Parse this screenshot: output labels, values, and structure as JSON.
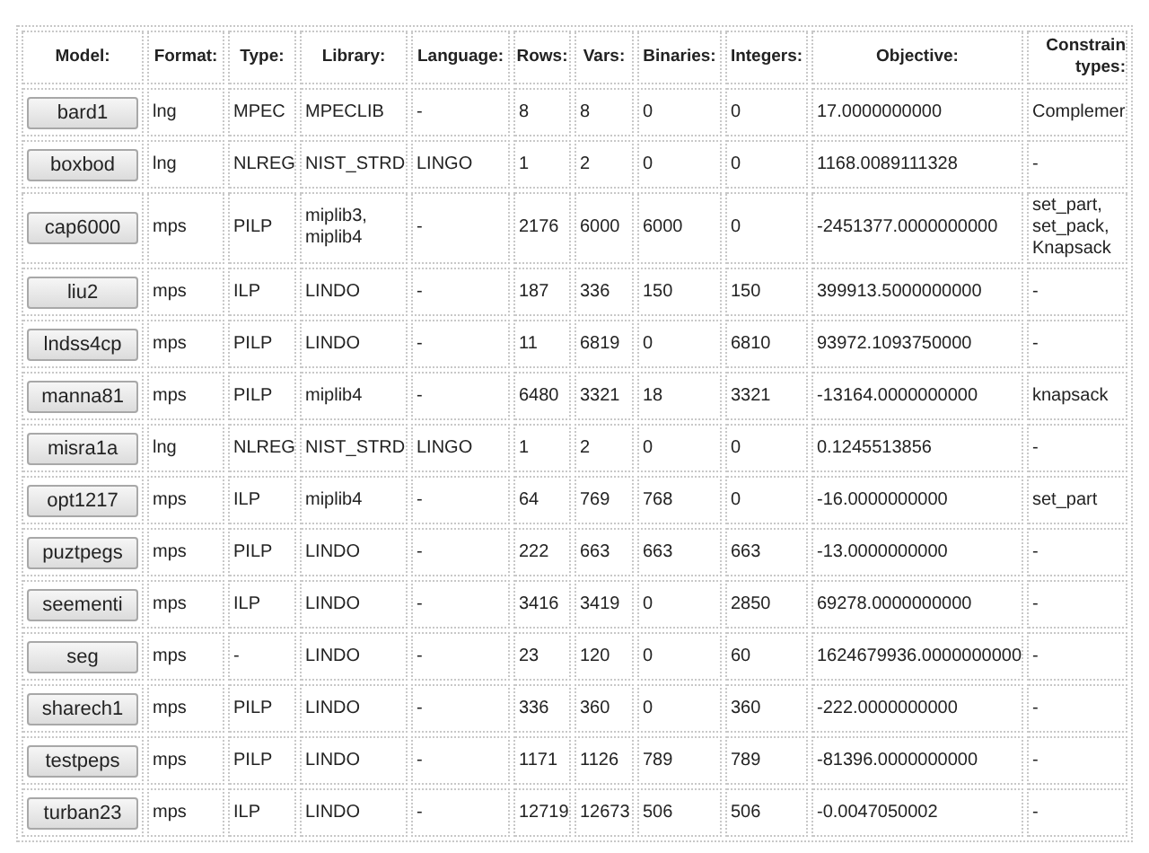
{
  "table": {
    "columns": [
      "Model:",
      "Format:",
      "Type:",
      "Library:",
      "Language:",
      "Rows:",
      "Vars:",
      "Binaries:",
      "Integers:",
      "Objective:",
      "Constrain types:"
    ],
    "rows": [
      {
        "cells": [
          "bard1",
          "lng",
          "MPEC",
          "MPECLIB",
          "-",
          "8",
          "8",
          "0",
          "0",
          "17.0000000000",
          "Complemer"
        ]
      },
      {
        "cells": [
          "boxbod",
          "lng",
          "NLREG",
          "NIST_STRD",
          "LINGO",
          "1",
          "2",
          "0",
          "0",
          "1168.0089111328",
          "-"
        ]
      },
      {
        "cells": [
          "cap6000",
          "mps",
          "PILP",
          "miplib3, miplib4",
          "-",
          "2176",
          "6000",
          "6000",
          "0",
          "-2451377.0000000000",
          "set_part, set_pack, Knapsack"
        ]
      },
      {
        "cells": [
          "liu2",
          "mps",
          "ILP",
          "LINDO",
          "-",
          "187",
          "336",
          "150",
          "150",
          "399913.5000000000",
          "-"
        ]
      },
      {
        "cells": [
          "lndss4cp",
          "mps",
          "PILP",
          "LINDO",
          "-",
          "11",
          "6819",
          "0",
          "6810",
          "93972.1093750000",
          "-"
        ]
      },
      {
        "cells": [
          "manna81",
          "mps",
          "PILP",
          "miplib4",
          "-",
          "6480",
          "3321",
          "18",
          "3321",
          "-13164.0000000000",
          "knapsack"
        ]
      },
      {
        "cells": [
          "misra1a",
          "lng",
          "NLREG",
          "NIST_STRD",
          "LINGO",
          "1",
          "2",
          "0",
          "0",
          "0.1245513856",
          "-"
        ]
      },
      {
        "cells": [
          "opt1217",
          "mps",
          "ILP",
          "miplib4",
          "-",
          "64",
          "769",
          "768",
          "0",
          "-16.0000000000",
          "set_part"
        ]
      },
      {
        "cells": [
          "puztpegs",
          "mps",
          "PILP",
          "LINDO",
          "-",
          "222",
          "663",
          "663",
          "663",
          "-13.0000000000",
          "-"
        ]
      },
      {
        "cells": [
          "seementi",
          "mps",
          "ILP",
          "LINDO",
          "-",
          "3416",
          "3419",
          "0",
          "2850",
          "69278.0000000000",
          "-"
        ]
      },
      {
        "cells": [
          "seg",
          "mps",
          "-",
          "LINDO",
          "-",
          "23",
          "120",
          "0",
          "60",
          "1624679936.0000000000",
          "-"
        ]
      },
      {
        "cells": [
          "sharech1",
          "mps",
          "PILP",
          "LINDO",
          "-",
          "336",
          "360",
          "0",
          "360",
          "-222.0000000000",
          "-"
        ]
      },
      {
        "cells": [
          "testpeps",
          "mps",
          "PILP",
          "LINDO",
          "-",
          "1171",
          "1126",
          "789",
          "789",
          "-81396.0000000000",
          "-"
        ]
      },
      {
        "cells": [
          "turban23",
          "mps",
          "ILP",
          "LINDO",
          "-",
          "12719",
          "12673",
          "506",
          "506",
          "-0.0047050002",
          "-"
        ]
      }
    ]
  }
}
